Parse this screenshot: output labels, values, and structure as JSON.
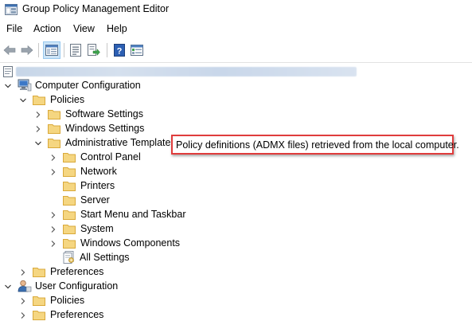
{
  "window": {
    "title": "Group Policy Management Editor"
  },
  "menu": {
    "file": "File",
    "action": "Action",
    "view": "View",
    "help": "Help"
  },
  "tree": {
    "computer_configuration": "Computer Configuration",
    "policies": "Policies",
    "software_settings": "Software Settings",
    "windows_settings": "Windows Settings",
    "administrative_templates": "Administrative Templates",
    "control_panel": "Control Panel",
    "network": "Network",
    "printers": "Printers",
    "server": "Server",
    "start_menu": "Start Menu and Taskbar",
    "system": "System",
    "windows_components": "Windows Components",
    "all_settings": "All Settings",
    "preferences": "Preferences",
    "user_configuration": "User Configuration",
    "user_policies": "Policies",
    "user_preferences": "Preferences"
  },
  "callout": {
    "text": "Policy definitions (ADMX files) retrieved from the local computer."
  },
  "colors": {
    "folder_fill": "#f5d681",
    "folder_edge": "#d9a93a",
    "callout_border": "#e03c3c",
    "selected_bg": "#cce4f7"
  },
  "icons": [
    "back-arrow-icon",
    "forward-arrow-icon",
    "show-tree-icon",
    "properties-icon",
    "export-icon",
    "help-icon",
    "filter-icon"
  ]
}
